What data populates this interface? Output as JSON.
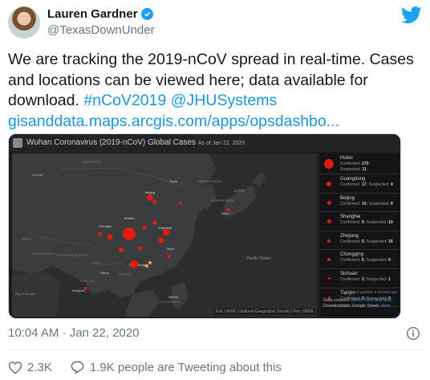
{
  "author": {
    "name": "Lauren Gardner",
    "handle": "@TexasDownUnder"
  },
  "tweet": {
    "text_line": "We are tracking the 2019-nCoV spread in real-time. Cases and locations can be viewed here; data available for download. ",
    "hashtag": "#nCoV2019",
    "mention": "@JHUSystems",
    "link": "gisanddata.maps.arcgis.com/apps/opsdashbo..."
  },
  "card": {
    "title": "Wuhan Coronavirus (2019-nCoV) Global Cases",
    "as_of": "As of Jan 22, 2020",
    "map_labels": {
      "mongolia": "MONGOLIA",
      "north_korea": "NORTH KOREA",
      "south_korea": "SOUTH KOREA",
      "japan": "JAPAN",
      "nepal": "NEPAL",
      "bangladesh": "BANGLADESH",
      "myanmar": "MYANMAR (BURMA)",
      "laos": "LAOS",
      "thailand": "THAILAND",
      "vietnam": "VIETNAM",
      "philippines": "PHILIPPINES",
      "pacific": "Pacific Ocean",
      "bengal": "Bay of Bengal",
      "beijing": "Beijing",
      "shanghai": "Shanghai",
      "chengdu": "Chengdu",
      "wuhan": "Wuhan",
      "taipei": "Taipei",
      "hanoi": "Hanoi",
      "manila": "Manila",
      "bangkok": "Bangkok",
      "tokyo": "Tokyo",
      "seoul": "Seoul",
      "urumqi": "Urumqi",
      "hong_kong": "Hong Kong"
    },
    "attribution": "Esri, HERE | National Geographic Society | Esri, HERE",
    "panel": [
      {
        "location": "Hubei",
        "confirmed": "270",
        "suspected": "11",
        "size": 12
      },
      {
        "location": "Guangdong",
        "confirmed": "17",
        "suspected": "4",
        "size": 6
      },
      {
        "location": "Beijing",
        "confirmed": "10",
        "suspected": "0",
        "size": 5
      },
      {
        "location": "Shanghai",
        "confirmed": "9",
        "suspected": "10",
        "size": 5
      },
      {
        "location": "Zhejiang",
        "confirmed": "5",
        "suspected": "16",
        "size": 4
      },
      {
        "location": "Chongqing",
        "confirmed": "5",
        "suspected": "0",
        "size": 4
      },
      {
        "location": "Sichuan",
        "confirmed": "2",
        "suspected": "1",
        "size": 3
      },
      {
        "location": "Tianjin",
        "confirmed": "2",
        "suspected": "0",
        "size": 3
      }
    ],
    "confirmed_label": "Confirmed:",
    "suspected_label": "Suspected:",
    "last_updated": "Last updated: 0 minutes ago",
    "sources_prefix": "Data sources: ",
    "sources_links": "WHO, CDC and NHC",
    "download_prefix": "Downloadable Google Sheet: ",
    "download_link": "Here"
  },
  "timestamp": "10:04 AM · Jan 22, 2020",
  "actions": {
    "likes": "2.3K",
    "reply_text": "1.9K people are Tweeting about this"
  },
  "colors": {
    "twitter_blue": "#1da1f2",
    "link_blue": "#1b95e0",
    "case_red": "#e11c0f",
    "muted": "#657786"
  },
  "icons": [
    "verified-badge-icon",
    "twitter-bird-icon",
    "info-icon",
    "heart-icon",
    "speech-bubble-icon"
  ]
}
